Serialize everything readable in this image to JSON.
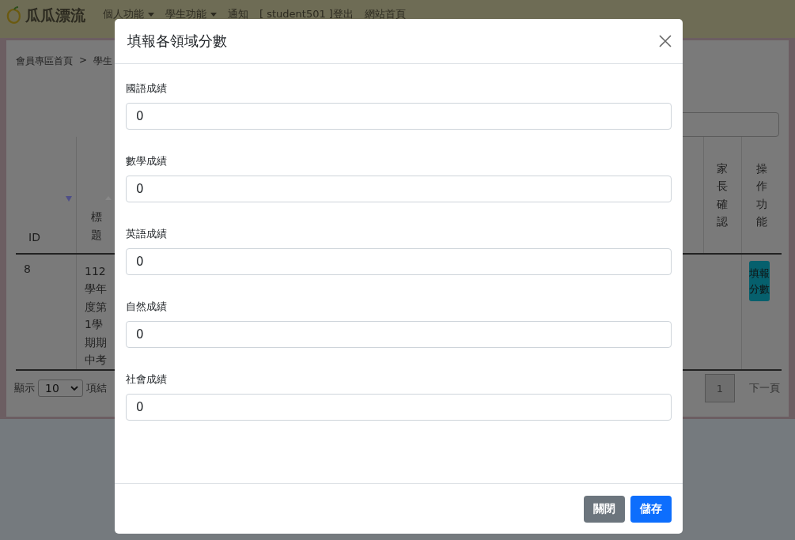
{
  "brand": {
    "name": "瓜瓜漂流"
  },
  "nav": [
    {
      "label": "個人功能",
      "dropdown": true
    },
    {
      "label": "學生功能",
      "dropdown": true
    },
    {
      "label": "通知",
      "dropdown": false
    },
    {
      "label": "[ student501 ]登出",
      "dropdown": false
    },
    {
      "label": "網站首頁",
      "dropdown": false
    }
  ],
  "breadcrumb": {
    "items": [
      "會員專區首頁",
      "學生"
    ],
    "separator": ">"
  },
  "table": {
    "columns": [
      {
        "label": "ID",
        "sorted": true
      },
      {
        "label": "標題",
        "sorted": false
      },
      {
        "label": "家長確認"
      },
      {
        "label": "操作功能"
      }
    ],
    "rows": [
      {
        "id": "8",
        "title": "112學年度第1學期期中考",
        "action": "填報分數"
      }
    ]
  },
  "length_menu": {
    "before": "顯示",
    "value": "10",
    "after": "項結"
  },
  "pagination": {
    "pages": [
      {
        "label": "1",
        "selected": true
      }
    ],
    "next": "下一頁"
  },
  "modal": {
    "title": "填報各領域分數",
    "fields": [
      {
        "label": "國語成績",
        "value": "0"
      },
      {
        "label": "數學成績",
        "value": "0"
      },
      {
        "label": "英語成績",
        "value": "0"
      },
      {
        "label": "自然成績",
        "value": "0"
      },
      {
        "label": "社會成績",
        "value": "0"
      }
    ],
    "buttons": [
      {
        "label": "關閉",
        "kind": "secondary"
      },
      {
        "label": "儲存",
        "kind": "primary"
      }
    ]
  }
}
